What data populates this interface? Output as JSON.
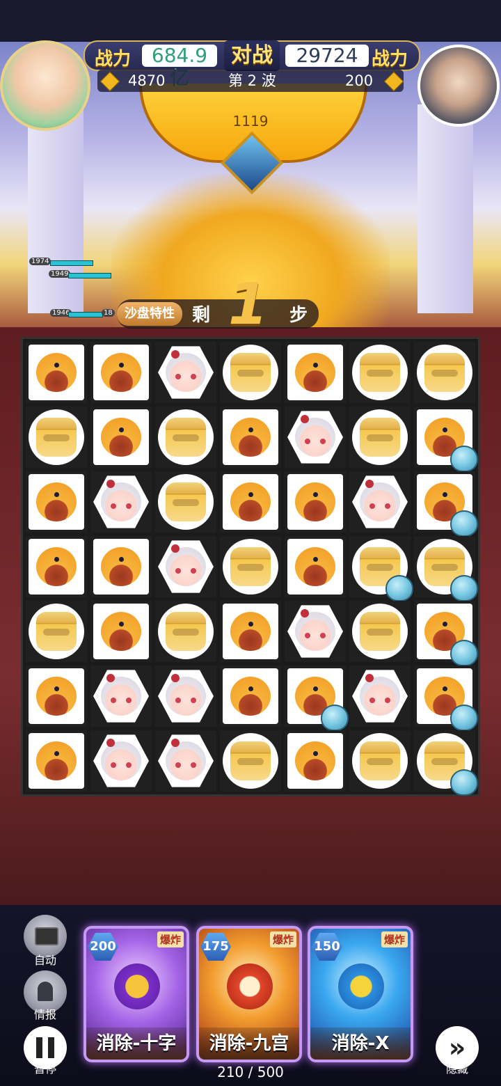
{
  "hud": {
    "player_power_label": "战力",
    "player_power": "684.9亿",
    "vs_label": "对战",
    "enemy_power": "29724",
    "enemy_power_label": "战力",
    "player_gold": "4870",
    "wave": "第 2 波",
    "enemy_gold": "200",
    "pot_value": "1119"
  },
  "steps": {
    "trait_label": "沙盘特性",
    "remain_label": "剩",
    "count": "1",
    "unit": "步"
  },
  "hp_tags": [
    "1974",
    "1949",
    "1946",
    "18"
  ],
  "board": {
    "rows": [
      [
        "hood",
        "hood",
        "girl",
        "helm",
        "hood",
        "helm",
        "helm"
      ],
      [
        "helm",
        "hood",
        "helm",
        "hood",
        "girl",
        "helm",
        "hood"
      ],
      [
        "hood",
        "girl",
        "helm",
        "hood",
        "hood",
        "girl",
        "hood"
      ],
      [
        "hood",
        "hood",
        "girl",
        "helm",
        "hood",
        "helm",
        "helm"
      ],
      [
        "helm",
        "hood",
        "helm",
        "hood",
        "girl",
        "helm",
        "hood"
      ],
      [
        "hood",
        "girl",
        "girl",
        "hood",
        "hood",
        "girl",
        "hood"
      ],
      [
        "hood",
        "girl",
        "girl",
        "helm",
        "hood",
        "helm",
        "helm"
      ]
    ],
    "slimes": [
      [
        1,
        6
      ],
      [
        2,
        6
      ],
      [
        3,
        5
      ],
      [
        3,
        6
      ],
      [
        4,
        6
      ],
      [
        5,
        4
      ],
      [
        5,
        6
      ],
      [
        6,
        6
      ]
    ]
  },
  "side_buttons": {
    "auto": "自动",
    "intel": "情报",
    "pause": "暂停",
    "hide": "隐藏"
  },
  "cards": [
    {
      "cost": "200",
      "tag": "爆炸",
      "name": "消除-十字",
      "color": "#8a3bd6"
    },
    {
      "cost": "175",
      "tag": "爆炸",
      "name": "消除-九宫",
      "color": "#e2462a"
    },
    {
      "cost": "150",
      "tag": "爆炸",
      "name": "消除-X",
      "color": "#2c8ee0"
    }
  ],
  "energy": "210 / 500",
  "icons": {
    "coin": "diamond-coin-icon",
    "auto": "monitor-icon",
    "intel": "bell-icon",
    "pause": "pause-icon",
    "hide": "double-chevron-right-icon"
  }
}
